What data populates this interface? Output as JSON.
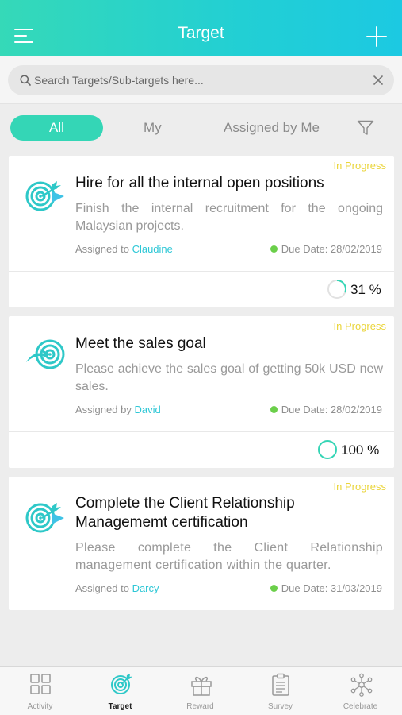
{
  "header": {
    "title": "Target",
    "menu_icon": "hamburger-menu-icon",
    "add_icon": "plus-icon"
  },
  "search": {
    "placeholder": "Search Targets/Sub-targets here...",
    "value": ""
  },
  "filters": {
    "tabs": [
      "All",
      "My",
      "Assigned by Me"
    ],
    "selected": "All",
    "filter_icon": "funnel-icon"
  },
  "colors": {
    "accent": "#34d6b6",
    "status": "#ead53b",
    "link": "#2dc7d6",
    "due_dot": "#6bcf4a"
  },
  "targets": [
    {
      "status": "In Progress",
      "title": "Hire for all the internal open positions",
      "description": "Finish the internal recruitment for the ongoing Malaysian projects.",
      "assign_label": "Assigned to",
      "assignee": "Claudine",
      "due": "Due Date: 28/02/2019",
      "progress_text": "31 %",
      "progress": 31
    },
    {
      "status": "In Progress",
      "title": "Meet the sales goal",
      "description": "Please achieve the sales goal of getting 50k USD new sales.",
      "assign_label": "Assigned by",
      "assignee": "David",
      "due": "Due Date: 28/02/2019",
      "progress_text": "100 %",
      "progress": 100
    },
    {
      "status": "In Progress",
      "title": "Complete the Client Relationship Managememt certification",
      "description": "Please complete the Client Relationship management certification within the quarter.",
      "assign_label": "Assigned to",
      "assignee": "Darcy",
      "due": "Due Date: 31/03/2019"
    }
  ],
  "nav": [
    {
      "label": "Activity",
      "icon": "grid-icon"
    },
    {
      "label": "Target",
      "icon": "target-icon",
      "active": true
    },
    {
      "label": "Reward",
      "icon": "gift-icon"
    },
    {
      "label": "Survey",
      "icon": "clipboard-icon"
    },
    {
      "label": "Celebrate",
      "icon": "network-icon"
    }
  ]
}
